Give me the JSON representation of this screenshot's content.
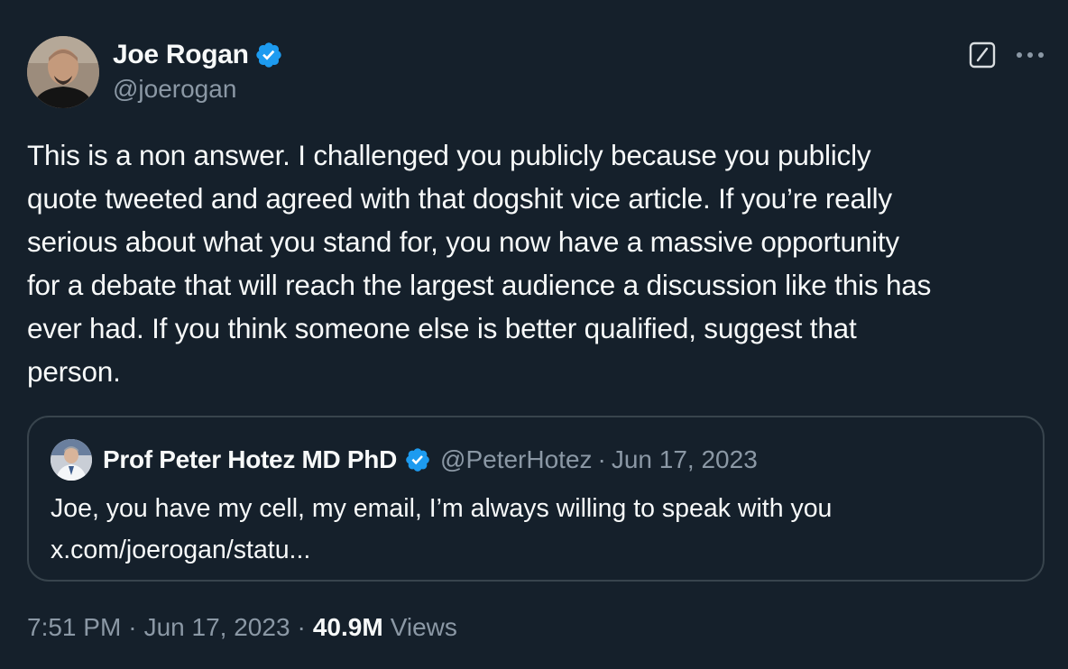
{
  "author": {
    "display_name": "Joe Rogan",
    "handle": "@joerogan",
    "verified": true
  },
  "tweet": {
    "text_lines": [
      "This is a non answer.  I challenged you publicly because you publicly",
      "quote tweeted and agreed with that dogshit vice article.  If you’re really",
      "serious about what you stand for, you now have a massive opportunity",
      "for a debate that will reach the largest audience a discussion like this has",
      "ever had.  If you think someone else is better qualified, suggest that",
      "person."
    ]
  },
  "quoted_tweet": {
    "display_name": "Prof Peter Hotez MD PhD",
    "handle": "@PeterHotez",
    "separator": "·",
    "date": "Jun 17, 2023",
    "verified": true,
    "text_lines": [
      "Joe, you have my cell, my email, I’m always willing to speak with you",
      "x.com/joerogan/statu..."
    ]
  },
  "meta": {
    "time": "7:51 PM",
    "separator": "·",
    "date": "Jun 17, 2023",
    "views_count": "40.9M",
    "views_label": "Views"
  },
  "icons": {
    "verified_badge": "verified-badge-icon",
    "grok": "grok-icon",
    "more": "more-options-icon"
  },
  "colors": {
    "background": "#15202b",
    "text_primary": "#f7f9f9",
    "text_secondary": "#8b98a5",
    "verified_blue": "#1d9bf0",
    "border": "#38444d"
  }
}
